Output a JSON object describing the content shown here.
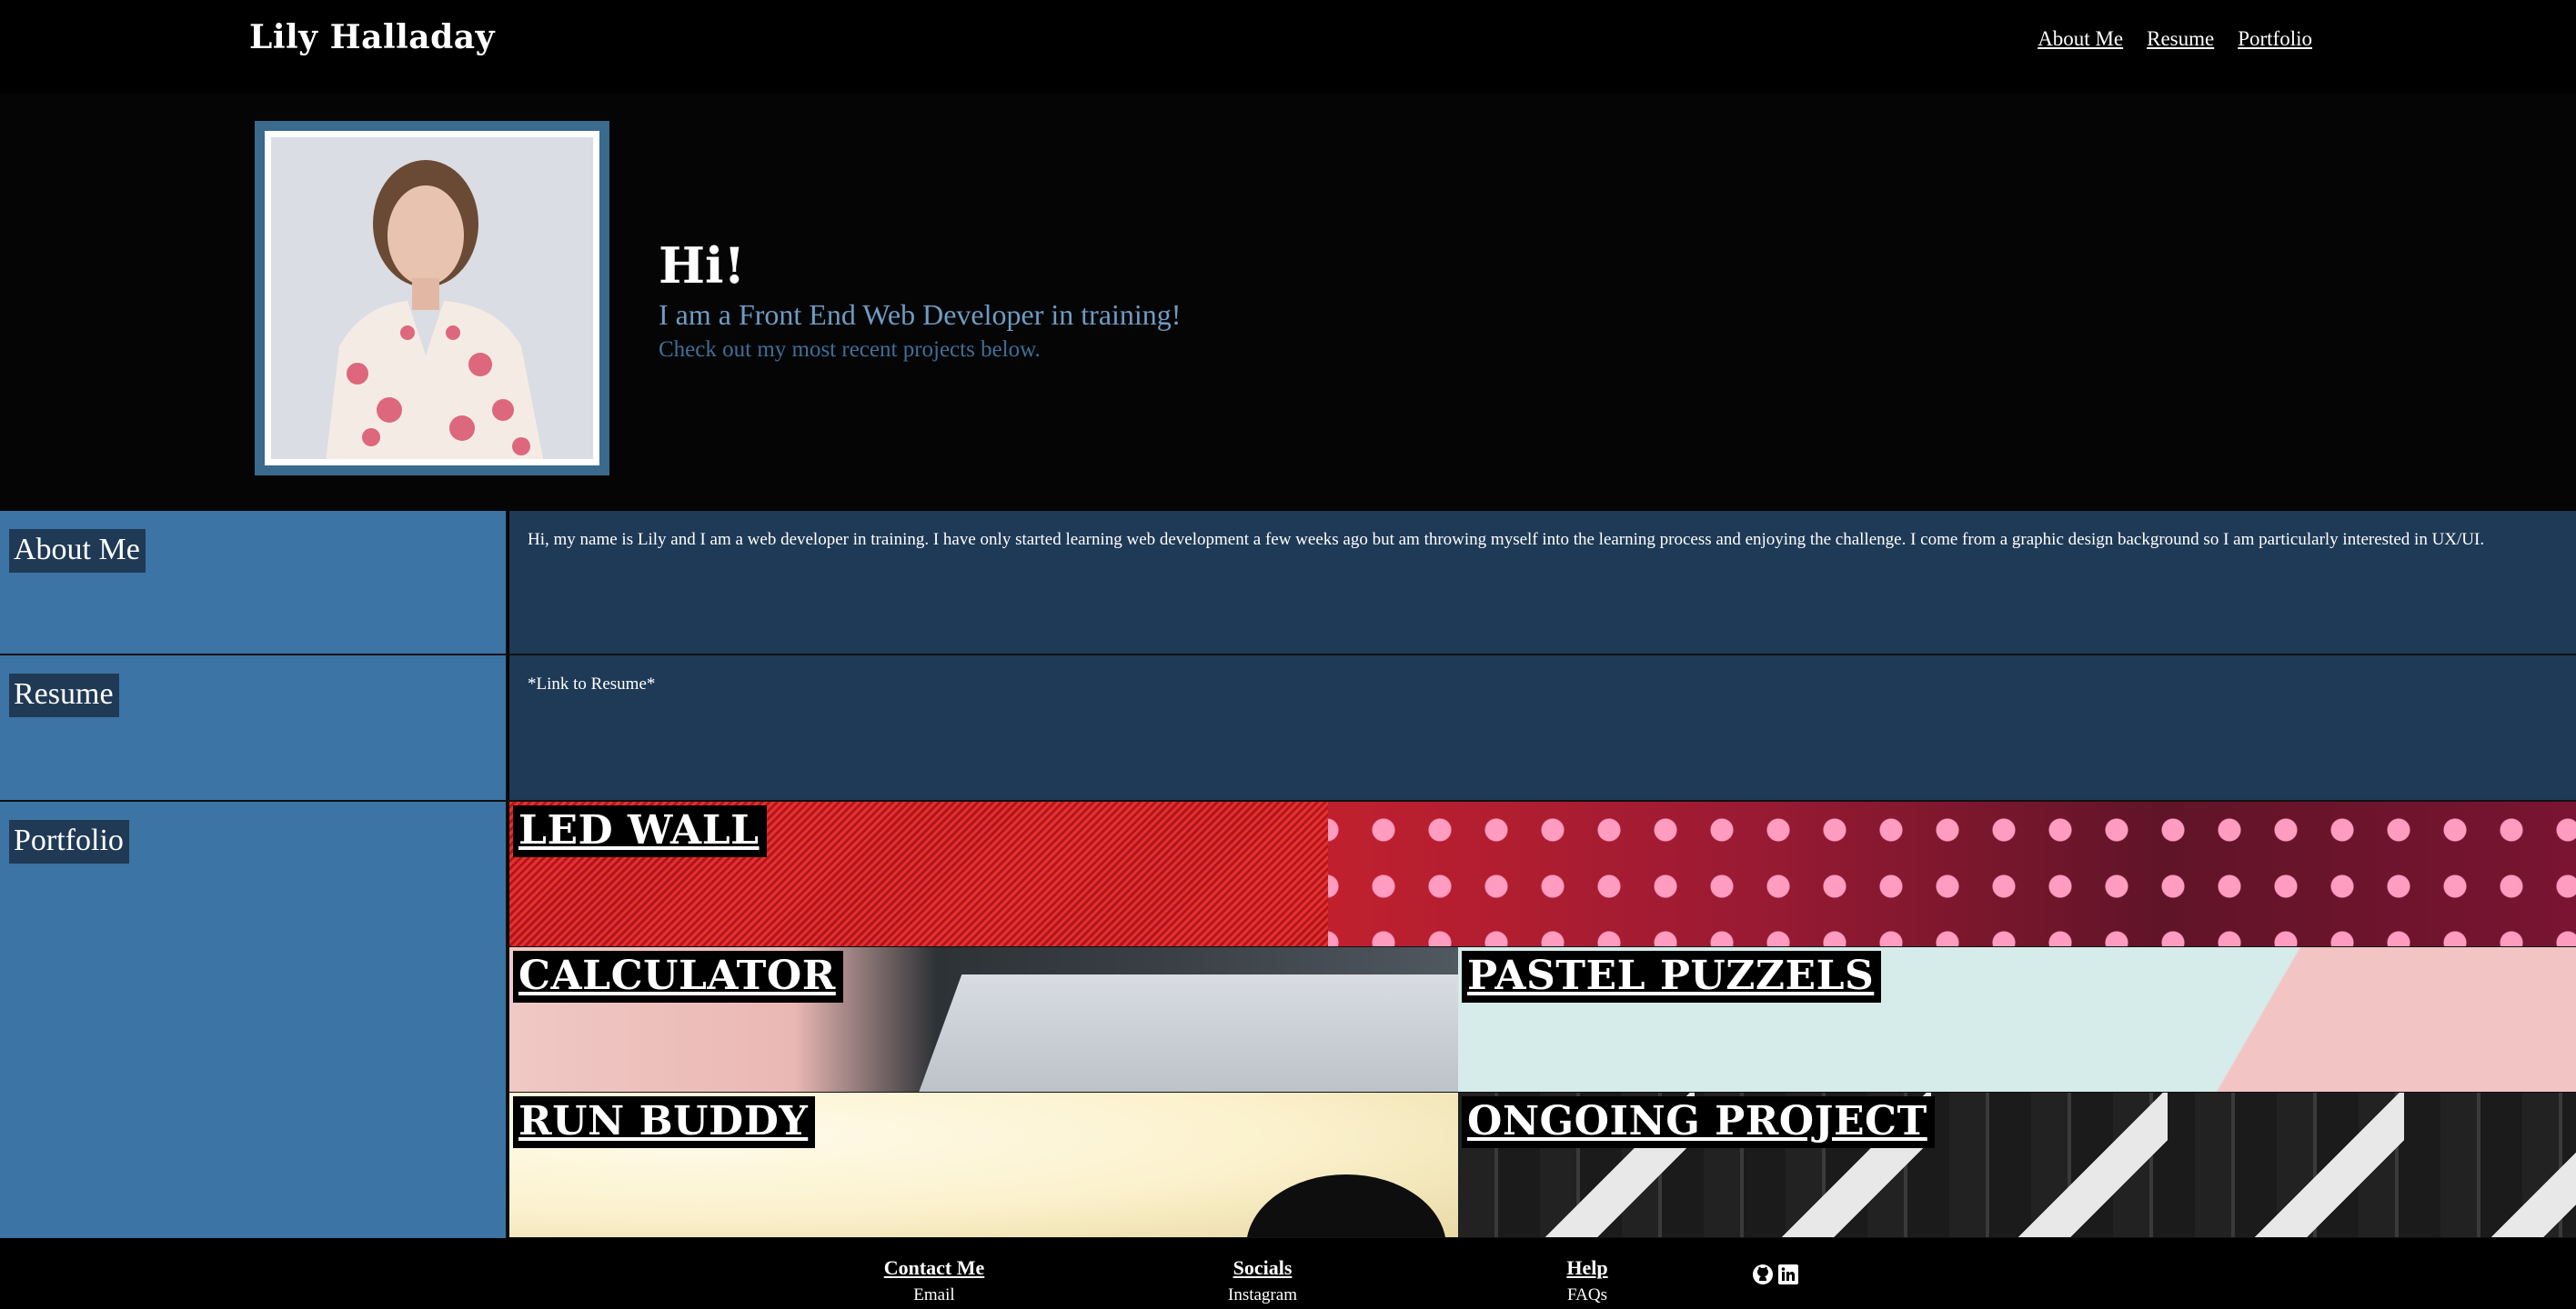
{
  "header": {
    "title": "Lily Halladay",
    "nav": [
      "About Me",
      "Resume",
      "Portfolio"
    ]
  },
  "hero": {
    "heading": "Hi!",
    "subheading": "I am a Front End Web Developer in training!",
    "tagline": "Check out my most recent projects below."
  },
  "about": {
    "label": "About Me",
    "text": "Hi, my name is Lily and I am a web developer in training. I have only started learning web development a few weeks ago but am throwing myself into the learning process and enjoying the challenge. I come from a graphic design background so I am particularly interested in UX/UI."
  },
  "resume": {
    "label": "Resume",
    "link_text": "*Link to Resume*"
  },
  "portfolio": {
    "label": "Portfolio",
    "projects": [
      "LED WALL",
      "CALCULATOR",
      "PASTEL PUZZELS",
      "RUN BUDDY",
      "ONGOING PROJECT"
    ]
  },
  "footer": {
    "contact": {
      "heading": "Contact Me",
      "link": "Email"
    },
    "socials": {
      "heading": "Socials",
      "link": "Instagram"
    },
    "help": {
      "heading": "Help",
      "link": "FAQs"
    },
    "icons": [
      "github-icon",
      "linkedin-icon"
    ]
  },
  "colors": {
    "accent_blue": "#3b74a5",
    "dark_blue": "#1f3a57",
    "hero_sub": "#6e9cc4"
  }
}
